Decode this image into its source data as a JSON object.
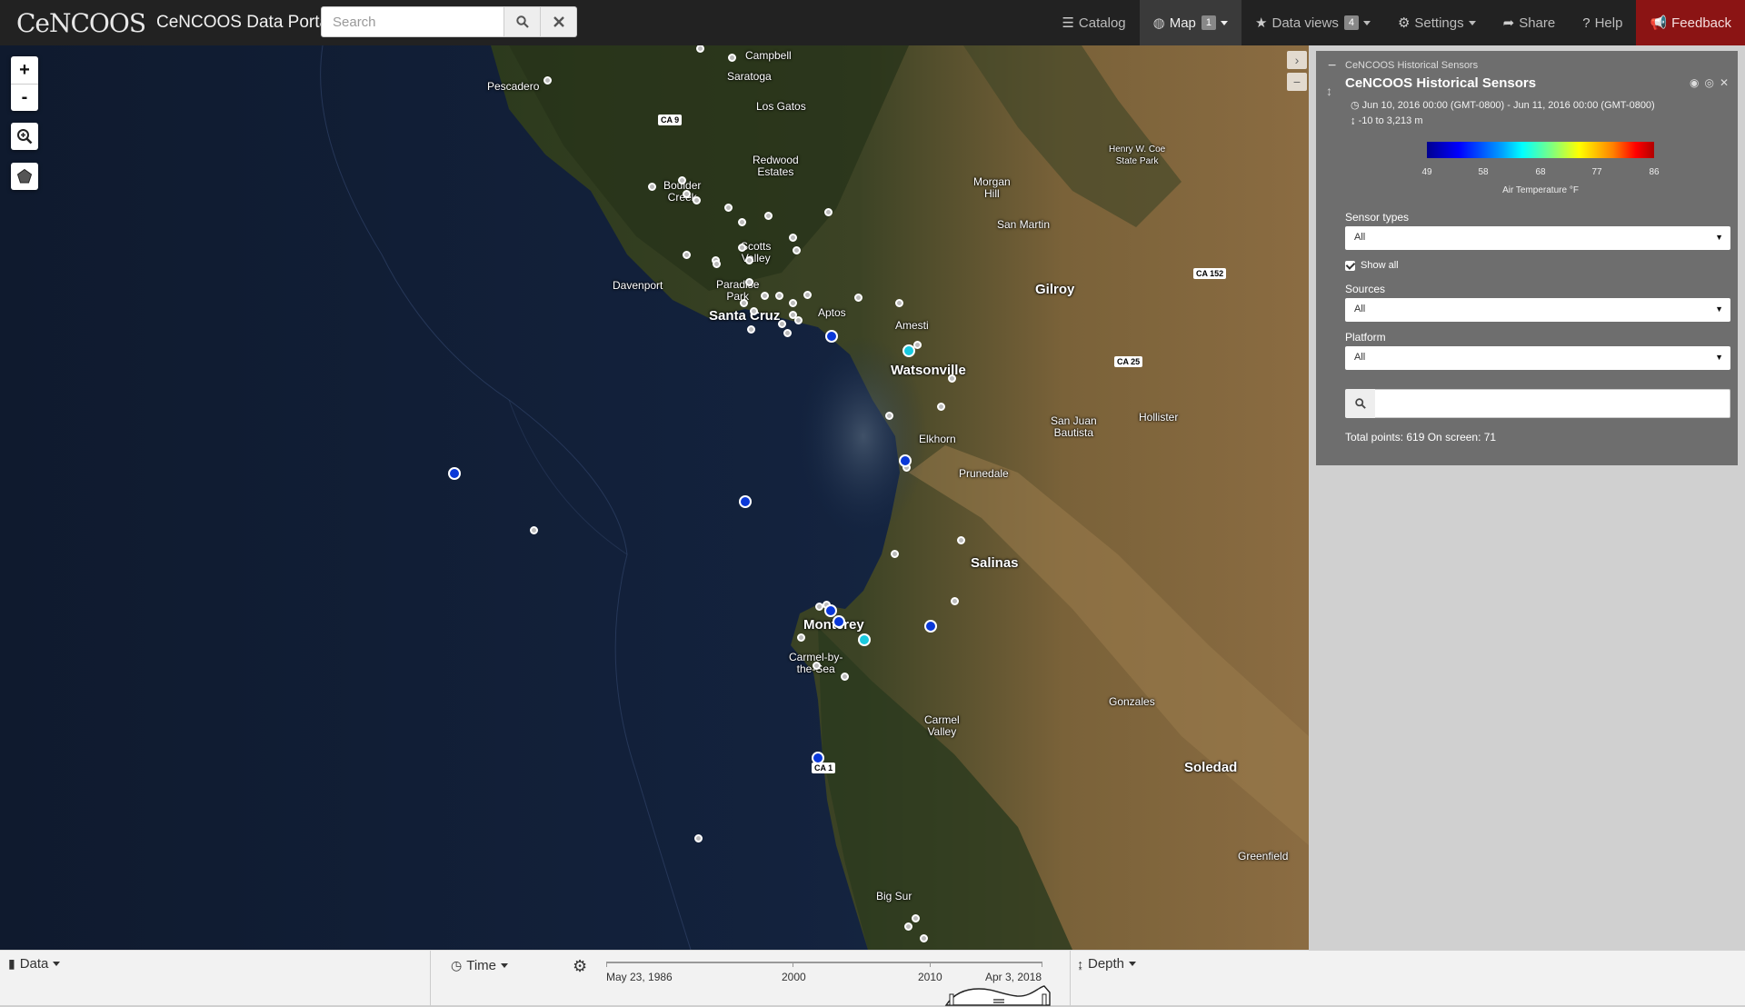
{
  "navbar": {
    "logo": "CeNCOOS",
    "title": "CeNCOOS Data Portal",
    "search_placeholder": "Search",
    "items": {
      "catalog": "Catalog",
      "map": "Map",
      "map_badge": "1",
      "data_views": "Data views",
      "data_views_badge": "4",
      "settings": "Settings",
      "share": "Share",
      "help": "Help",
      "feedback": "Feedback"
    }
  },
  "map": {
    "zoom_in": "+",
    "zoom_out": "-",
    "places": {
      "campbell": "Campbell",
      "saratoga": "Saratoga",
      "pescadero": "Pescadero",
      "los_gatos": "Los Gatos",
      "redwood_estates": "Redwood\nEstates",
      "boulder_creek": "Boulder\nCreek",
      "scotts_valley": "Scotts\nValley",
      "davenport": "Davenport",
      "paradise_park": "Paradise\nPark",
      "santa_cruz": "Santa Cruz",
      "aptos": "Aptos",
      "amesti": "Amesti",
      "watsonville": "Watsonville",
      "morgan_hill": "Morgan\nHill",
      "san_martin": "San Martin",
      "gilroy": "Gilroy",
      "henry_coe": "Henry W. Coe\nState Park",
      "san_juan_bautista": "San Juan\nBautista",
      "hollister": "Hollister",
      "elkhorn": "Elkhorn",
      "prunedale": "Prunedale",
      "salinas": "Salinas",
      "monterey": "Monterey",
      "carmel_by_the_sea": "Carmel-by-\nthe-Sea",
      "carmel_valley": "Carmel\nValley",
      "gonzales": "Gonzales",
      "soledad": "Soledad",
      "greenfield": "Greenfield",
      "big_sur": "Big Sur"
    },
    "highways": {
      "ca9": "CA 9",
      "ca152": "CA 152",
      "ca25": "CA 25",
      "ca1": "CA 1"
    }
  },
  "layer_panel": {
    "subtitle": "CeNCOOS Historical Sensors",
    "title": "CeNCOOS Historical Sensors",
    "time_range": "Jun 10, 2016 00:00 (GMT-0800) - Jun 11, 2016 00:00 (GMT-0800)",
    "depth_range": "-10 to 3,213 m",
    "colorbar": {
      "ticks": [
        "49",
        "58",
        "68",
        "77",
        "86"
      ],
      "label": "Air Temperature °F",
      "min": 49,
      "max": 86
    },
    "sensor_types_label": "Sensor types",
    "sensor_types_value": "All",
    "show_all_label": "Show all",
    "show_all_checked": true,
    "sources_label": "Sources",
    "sources_value": "All",
    "platform_label": "Platform",
    "platform_value": "All",
    "totals": "Total points: 619 On screen: 71"
  },
  "bottom_bar": {
    "data_label": "Data",
    "time_label": "Time",
    "depth_label": "Depth",
    "timeline": {
      "start_label": "May 23, 1986",
      "ticks": [
        "2000",
        "2010"
      ],
      "end_label": "Apr 3, 2018"
    }
  },
  "colors": {
    "navbar_bg": "#222222",
    "feedback_bg": "#8b1414",
    "panel_bg": "#6e6e6e",
    "sensor_blue": "#0a38d8",
    "sensor_cyan": "#19c9df"
  }
}
